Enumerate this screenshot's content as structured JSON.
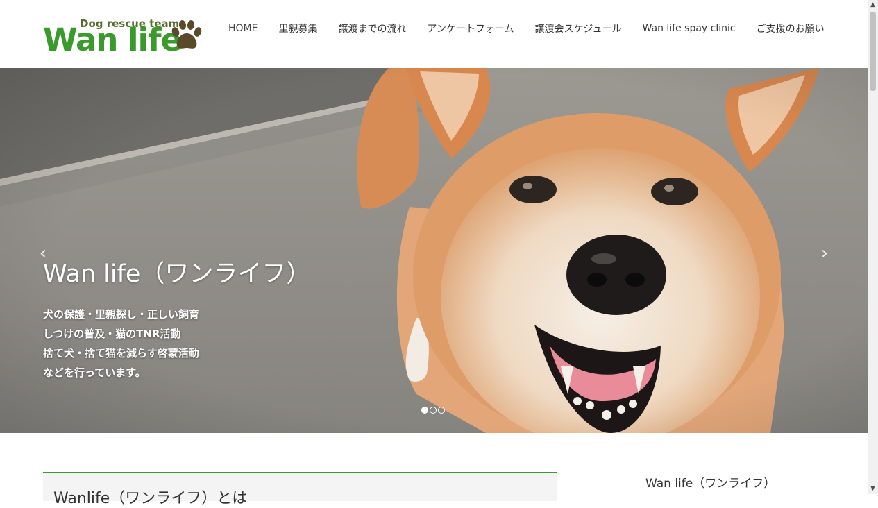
{
  "header": {
    "logo": {
      "tagline": "Dog rescue team",
      "name": "Wan life",
      "icon": "paw-icon",
      "color": "#3a9a2b"
    },
    "nav": [
      {
        "label": "HOME",
        "active": true
      },
      {
        "label": "里親募集"
      },
      {
        "label": "譲渡までの流れ"
      },
      {
        "label": "アンケートフォーム"
      },
      {
        "label": "譲渡会スケジュール"
      },
      {
        "label": "Wan life spay clinic"
      },
      {
        "label": "ご支援のお願い"
      }
    ]
  },
  "hero": {
    "title": "Wan life（ワンライフ）",
    "lines": [
      "犬の保護・里親探し・正しい飼育",
      "しつけの普及・猫のTNR活動",
      "捨て犬・捨て猫を減らす啓蒙活動",
      "などを行っています。"
    ],
    "prev_icon": "chevron-left-icon",
    "next_icon": "chevron-right-icon",
    "prev_glyph": "‹",
    "next_glyph": "›",
    "slides": 3,
    "active_slide": 1
  },
  "main": {
    "article_title": "Wanlife（ワンライフ）とは"
  },
  "sidebar": {
    "title": "Wan life（ワンライフ）"
  },
  "scrollbar": {
    "up_glyph": "▲",
    "down_glyph": "▼"
  }
}
